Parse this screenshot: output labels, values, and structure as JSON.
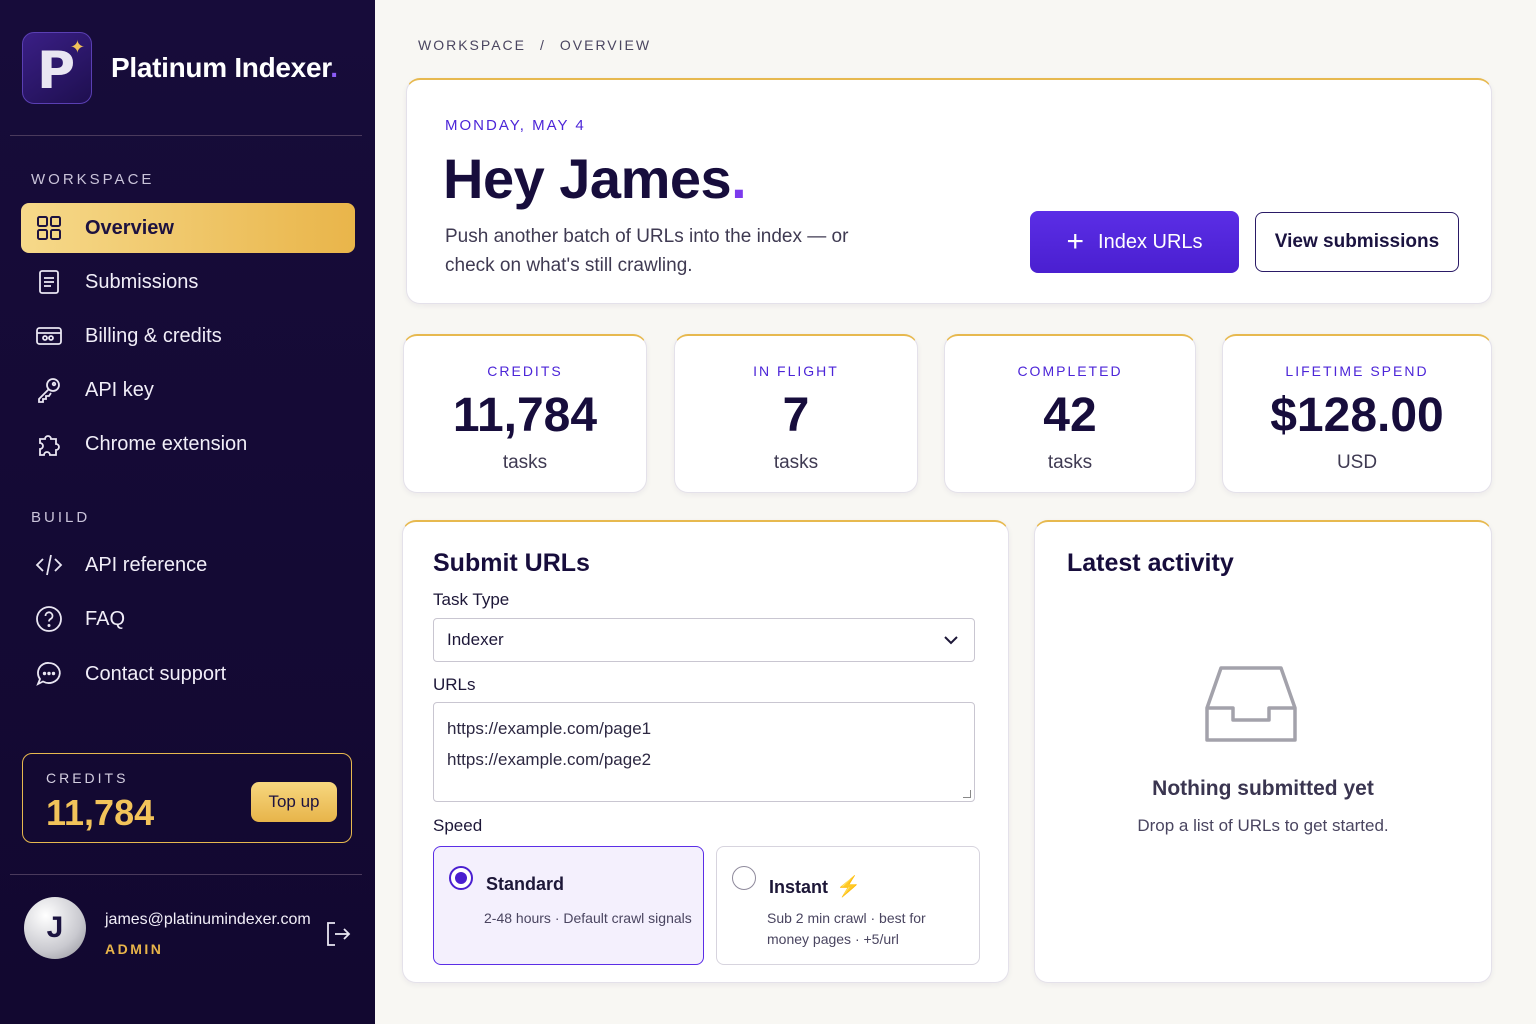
{
  "app": {
    "name": "Platinum Indexer",
    "name_dot": ".",
    "logo_letter": "P"
  },
  "sidebar": {
    "section_workspace": "WORKSPACE",
    "section_build": "BUILD",
    "workspace_items": [
      {
        "label": "Overview",
        "icon": "grid-icon",
        "active": true
      },
      {
        "label": "Submissions",
        "icon": "document-icon"
      },
      {
        "label": "Billing & credits",
        "icon": "ticket-icon"
      },
      {
        "label": "API key",
        "icon": "key-icon"
      },
      {
        "label": "Chrome extension",
        "icon": "puzzle-icon"
      }
    ],
    "build_items": [
      {
        "label": "API reference",
        "icon": "code-icon"
      },
      {
        "label": "FAQ",
        "icon": "question-icon"
      },
      {
        "label": "Contact support",
        "icon": "chat-icon"
      }
    ],
    "credits": {
      "label": "CREDITS",
      "value": "11,784",
      "topup_label": "Top up"
    },
    "user": {
      "initial": "J",
      "email": "james@platinumindexer.com",
      "role": "ADMIN"
    }
  },
  "breadcrumb": {
    "root": "WORKSPACE",
    "separator": "/",
    "current": "OVERVIEW"
  },
  "hero": {
    "date": "MONDAY, MAY 4",
    "greeting": "Hey James",
    "greeting_dot": ".",
    "subtitle": "Push another batch of URLs into the index — or check on what's still crawling.",
    "primary_button": "Index URLs",
    "secondary_button": "View submissions"
  },
  "stats": [
    {
      "label": "CREDITS",
      "value": "11,784",
      "unit": "tasks"
    },
    {
      "label": "IN FLIGHT",
      "value": "7",
      "unit": "tasks"
    },
    {
      "label": "COMPLETED",
      "value": "42",
      "unit": "tasks"
    },
    {
      "label": "LIFETIME SPEND",
      "value": "$128.00",
      "unit": "USD"
    }
  ],
  "submit_form": {
    "title": "Submit URLs",
    "task_type_label": "Task Type",
    "task_type_value": "Indexer",
    "urls_label": "URLs",
    "urls": [
      "https://example.com/page1",
      "https://example.com/page2"
    ],
    "speed_label": "Speed",
    "speed_options": [
      {
        "title": "Standard",
        "desc": "2-48 hours · Default crawl signals",
        "selected": true
      },
      {
        "title": "Instant",
        "desc_line1": "Sub 2 min crawl · best for",
        "desc_line2": "money pages · +5/url",
        "selected": false
      }
    ]
  },
  "activity": {
    "title": "Latest activity",
    "empty_title": "Nothing submitted yet",
    "empty_subtitle": "Drop a list of URLs to get started."
  },
  "colors": {
    "accent": "#4a1fd0",
    "gold": "#e9b54a",
    "sidebar_bg": "#170c3a"
  }
}
